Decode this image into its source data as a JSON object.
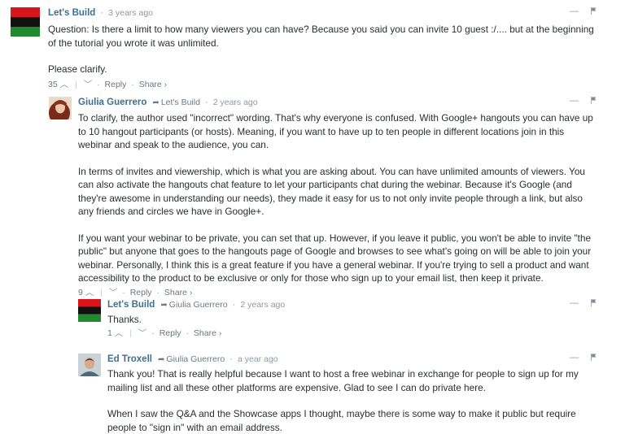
{
  "comments": [
    {
      "author": "Let's Build",
      "time": "3 years ago",
      "reply_to": "",
      "paragraphs": [
        "Question: Is there a limit to how many viewers you can have? Because you said you can invite 10 guest :/.... but at the beginning of the tutorial you wrote it was unlimited.",
        "Please clarify."
      ],
      "votes": "35",
      "reply_label": "Reply",
      "share_label": "Share ›",
      "minimize": "—",
      "avatar_colors": [
        "#d7161c",
        "#111111",
        "#1f8a2e"
      ]
    },
    {
      "author": "Giulia Guerrero",
      "time": "2 years ago",
      "reply_to": "Let's Build",
      "paragraphs": [
        "To clarify, the author used \"incorrect\" wording. That's why everyone is confused. With Google+ hangouts you can have up to 10 hangout participants (or hosts). Meaning, if you want to have up to ten people in different locations join in this webinar and speak to the audience, you can.",
        "In terms of invites and viewership, which is what you are asking about. You can have unlimited amounts of viewers. You can also activate the hangouts chat feature to let your participants chat during the webinar. Because it's Google (and they're awesome in understanding our needs), they made it easy for us to not only invite people through a link, but also any friends and circles we have in Google+.",
        "If you want your webinar to be private, you can set that up. However, if you leave it public, you won't be able to invite \"the public\" but anyone that goes to the hangouts page of Google and browses to see what's going on will be able to join your webinar. Personally, I think this is a great feature if you have a general webinar. If you're trying to sell a product and want accessibility to the product to be exclusive or only for those who sign up to your email list, then keep it private."
      ],
      "votes": "9",
      "reply_label": "Reply",
      "share_label": "Share ›",
      "minimize": "—"
    },
    {
      "author": "Let's Build",
      "time": "2 years ago",
      "reply_to": "Giulia Guerrero",
      "paragraphs": [
        "Thanks."
      ],
      "votes": "1",
      "reply_label": "Reply",
      "share_label": "Share ›",
      "minimize": "—"
    },
    {
      "author": "Ed Troxell",
      "time": "a year ago",
      "reply_to": "Giulia Guerrero",
      "paragraphs": [
        "Thank you! That is really helpful because I want to host a free webinar in exchange for people to sign up for my mailing list and all these other platforms are expensive. Glad to see I can do private here.",
        "When I saw the Q&A and the Showcase apps I thought, maybe there is some way to make it public but require people to \"sign in\" with an email address."
      ],
      "minimize": "—"
    }
  ],
  "icons": {
    "upvote": "⌃",
    "downvote": "⌄",
    "reply_arrow": "➦",
    "flag": "flag-icon"
  }
}
